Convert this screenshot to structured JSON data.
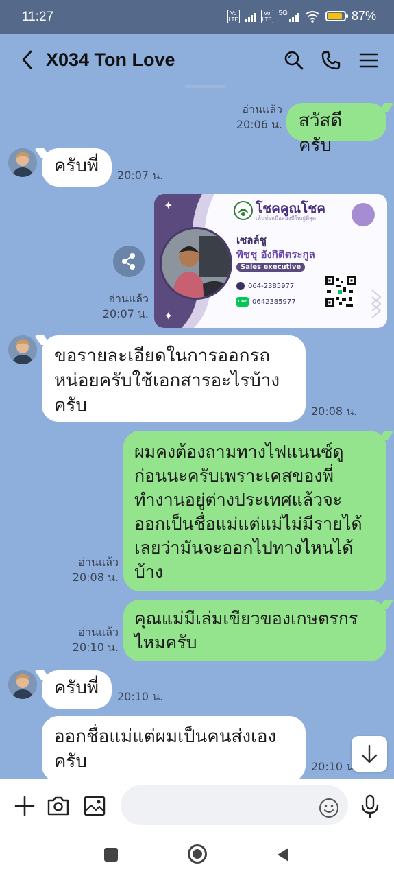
{
  "status": {
    "time": "11:27",
    "net1": "Vo LTE",
    "net2": "Vo LTE",
    "net2_gen": "5G",
    "battery_pct": "87%",
    "battery_level": 0.87
  },
  "header": {
    "title": "X034 Ton Love",
    "icons": [
      "back-icon",
      "search-icon",
      "phone-icon",
      "menu-icon"
    ]
  },
  "messages": {
    "m1": {
      "text": "สวัสดีครับ",
      "read": "อ่านแล้ว",
      "time": "20:06 น."
    },
    "m2": {
      "text": "ครับพี่",
      "time": "20:07 น."
    },
    "card": {
      "read": "อ่านแล้ว",
      "time": "20:07 น.",
      "brand": "โชคคูณโชค",
      "brand_sub": "เต้นท์รถมือสองที่ใหญ่ที่สุด",
      "nickname": "เซลล์ชู",
      "fullname": "พิชชุ อังกิติตระกูล",
      "role": "Sales executive",
      "phone": "064-2385977",
      "line": "0642385977",
      "line_badge": "LINE"
    },
    "m4": {
      "line1": "ขอรายละเอียดในการออกรถ",
      "line2": "หน่อยครับใช้เอกสารอะไรบ้าง",
      "line3": "ครับ",
      "time": "20:08 น."
    },
    "m5": {
      "line1": "ผมคงต้องถามทางไฟแนนซ์ดู",
      "line2": "ก่อนนะครับเพราะเคสของพี่",
      "line3": "ทำงานอยู่ต่างประเทศแล้วจะ",
      "line4": "ออกเป็นชื่อแม่แต่แม่ไม่มีรายได้",
      "line5": "เลยว่ามันจะออกไปทางไหนได้",
      "line6": "บ้าง",
      "read": "อ่านแล้ว",
      "time": "20:08 น."
    },
    "m6": {
      "line1": "คุณแม่มีเล่มเขียวของเกษตรกร",
      "line2": "ไหมครับ",
      "read": "อ่านแล้ว",
      "time": "20:10 น."
    },
    "m7": {
      "text": "ครับพี่",
      "time": "20:10 น."
    },
    "m8": {
      "line1": "ออกชื่อแม่แต่ผมเป็นคนส่งเอง",
      "line2": "ครับ",
      "time": "20:10 น."
    }
  },
  "input": {
    "placeholder": ""
  }
}
